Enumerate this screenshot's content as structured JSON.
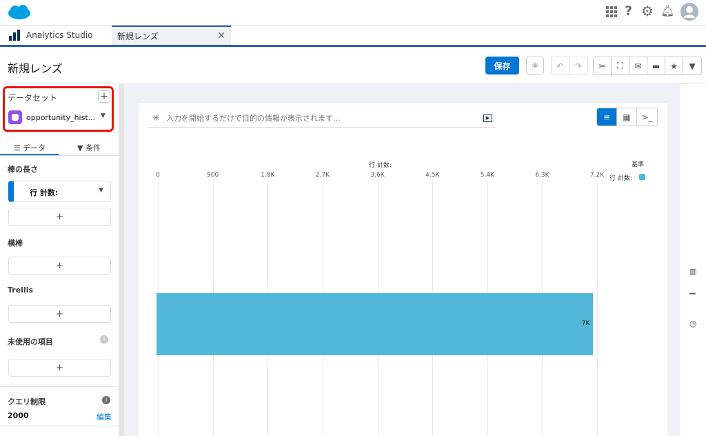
{
  "header": {
    "icons": [
      "salesforce-cloud-logo",
      "app-launcher-icon",
      "help-icon",
      "setup-gear-icon",
      "notification-bell-icon",
      "user-avatar"
    ]
  },
  "tabs": [
    {
      "label": "Analytics Studio"
    },
    {
      "label": "新規レンズ"
    }
  ],
  "title": "新規レンズ",
  "toolbar": {
    "save_label": "保存"
  },
  "left": {
    "dataset_label": "データセット",
    "dataset_name": "opportunity_hist...",
    "tab_data": "データ",
    "tab_filter": "条件",
    "bar_length_label": "棒の長さ",
    "measure": "行 計数:",
    "bars_label": "横棒",
    "trellis_label": "Trellis",
    "unused_label": "未使用の項目",
    "add": "+",
    "query_limit_label": "クエリ制限",
    "query_limit_value": "2000",
    "edit_link": "編集"
  },
  "search": {
    "placeholder": "入力を開始するだけで目的の情報が表示されます..."
  },
  "colors": {
    "accent": "#0176d3",
    "bar": "#52b7d8",
    "highlight": "#e8140c"
  },
  "chart_data": {
    "type": "bar",
    "orientation": "horizontal",
    "xlabel": "行 計数:",
    "ticks": [
      "0",
      "900",
      "1.8K",
      "2.7K",
      "3.6K",
      "4.5K",
      "5.4K",
      "6.3K",
      "7.2K"
    ],
    "xlim": [
      0,
      7200
    ],
    "categories": [
      ""
    ],
    "series": [
      {
        "name": "行 計数:",
        "values": [
          7130
        ]
      }
    ],
    "data_labels": [
      "7K"
    ],
    "legend_title": "基準",
    "legend_position": "top-right",
    "grid": true
  }
}
